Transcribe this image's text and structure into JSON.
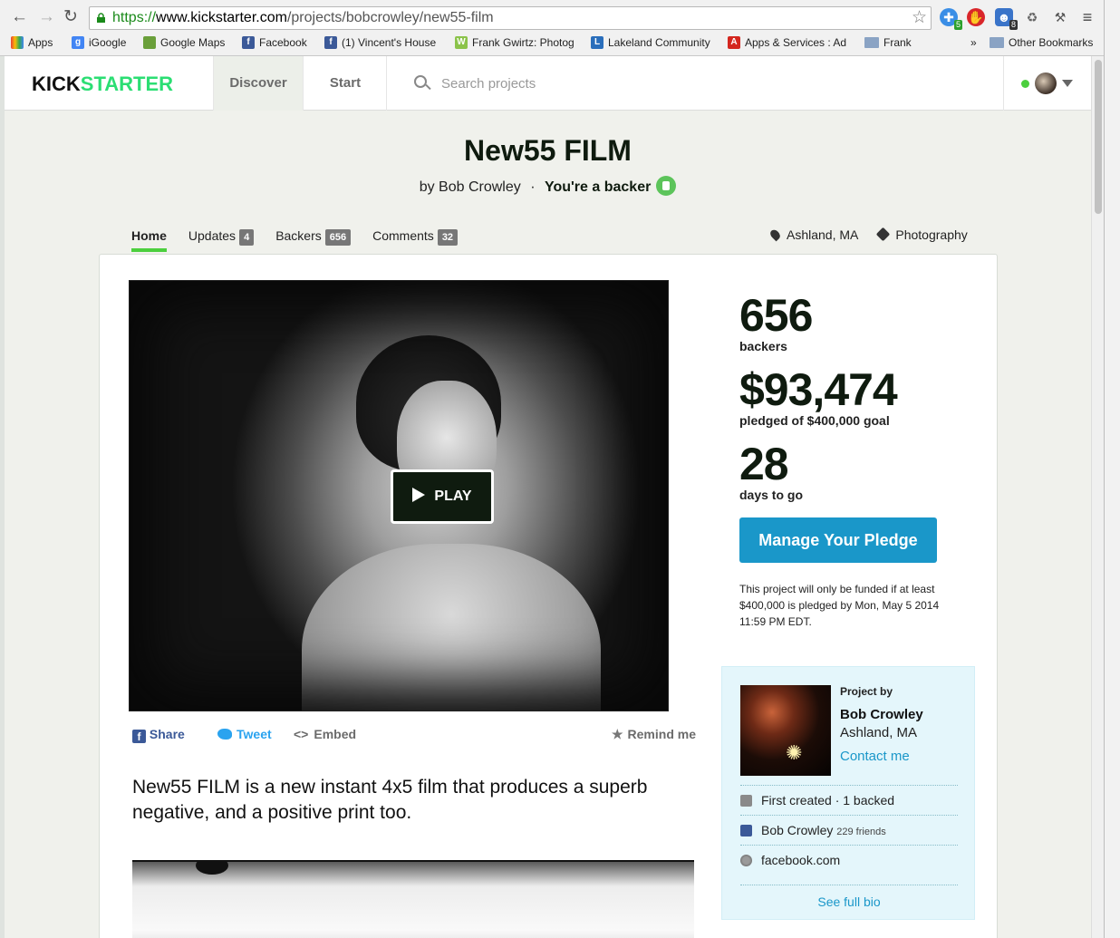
{
  "browser": {
    "url_proto": "https://",
    "url_host": "www.kickstarter.com",
    "url_path": "/projects/bobcrowley/new55-film",
    "extension_badges": [
      "5",
      "8"
    ],
    "bookmarks": [
      {
        "label": "Apps",
        "icon": "apps-grid-icon"
      },
      {
        "label": "iGoogle",
        "icon": "google-icon"
      },
      {
        "label": "Google Maps",
        "icon": "maps-icon"
      },
      {
        "label": "Facebook",
        "icon": "facebook-icon"
      },
      {
        "label": "(1) Vincent's House",
        "icon": "facebook-icon"
      },
      {
        "label": "Frank Gwirtz: Photog",
        "icon": "w-icon"
      },
      {
        "label": "Lakeland Community",
        "icon": "lakeland-icon"
      },
      {
        "label": "Apps & Services : Ad",
        "icon": "adobe-icon"
      },
      {
        "label": "Frank",
        "icon": "folder-icon"
      },
      {
        "label": "»",
        "icon": "overflow-icon"
      },
      {
        "label": "Other Bookmarks",
        "icon": "folder-icon"
      }
    ]
  },
  "site": {
    "logo_part1": "KICK",
    "logo_part2": "STARTER",
    "nav_discover": "Discover",
    "nav_start": "Start",
    "search_placeholder": "Search projects"
  },
  "project": {
    "title": "New55 FILM",
    "by": "by Bob Crowley",
    "sep": "·",
    "backer_status": "You're a backer",
    "tabs": [
      {
        "label": "Home",
        "count": ""
      },
      {
        "label": "Updates",
        "count": "4"
      },
      {
        "label": "Backers",
        "count": "656"
      },
      {
        "label": "Comments",
        "count": "32"
      }
    ],
    "location": "Ashland, MA",
    "category": "Photography",
    "play_label": "PLAY",
    "share": "Share",
    "tweet": "Tweet",
    "embed": "Embed",
    "remind": "Remind me",
    "blurb": "New55 FILM is a new instant 4x5 film that produces a superb negative, and a positive print too."
  },
  "stats": {
    "backers": "656",
    "backers_label": "backers",
    "pledged": "$93,474",
    "pledged_label": "pledged of $400,000 goal",
    "days": "28",
    "days_label": "days to go",
    "manage_button": "Manage Your Pledge",
    "funding_note": "This project will only be funded if at least $400,000 is pledged by Mon, May 5 2014 11:59 PM EDT."
  },
  "creator": {
    "heading": "Project by",
    "name": "Bob Crowley",
    "location": "Ashland, MA",
    "contact": "Contact me",
    "history": "First created · 1 backed",
    "fb_name": "Bob Crowley",
    "fb_friends": "229 friends",
    "website": "facebook.com",
    "full_bio": "See full bio"
  },
  "colors": {
    "kickstarter_green": "#2bde73",
    "button_blue": "#1a97c9",
    "active_tab": "#4ccf3e",
    "facebook_blue": "#3b5998"
  }
}
